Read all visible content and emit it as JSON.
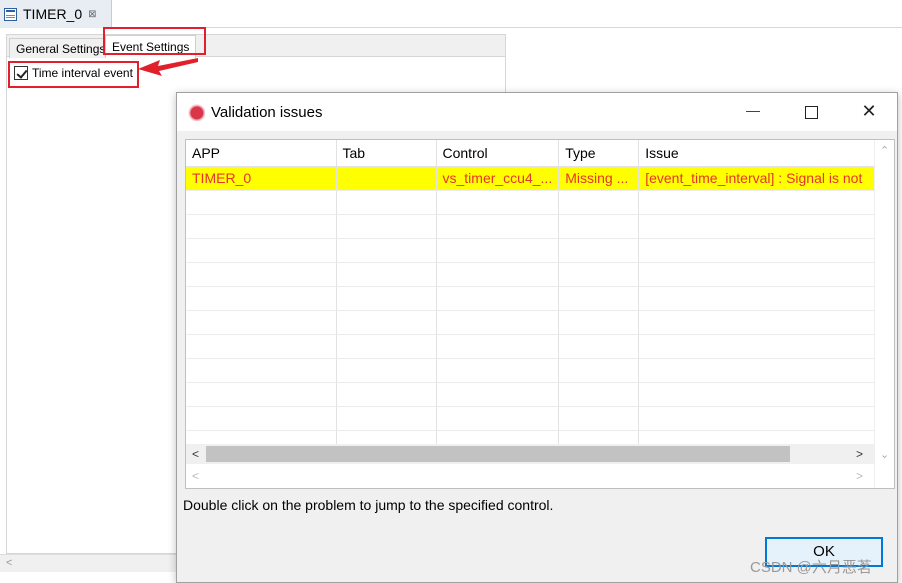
{
  "editor": {
    "tab_title": "TIMER_0",
    "close_glyph": "⊠",
    "settings_tabs": [
      "General Settings",
      "Event Settings"
    ],
    "checkbox_label": "Time interval event",
    "checkbox_checked": true
  },
  "dialog": {
    "title": "Validation issues",
    "columns": [
      "APP",
      "Tab",
      "Control",
      "Type",
      "Issue"
    ],
    "rows": [
      [
        "TIMER_0",
        "",
        "vs_timer_ccu4_...",
        "Missing ...",
        "[event_time_interval] : Signal is not"
      ]
    ],
    "empty_row_count": 11,
    "hint": "Double click on the problem to jump to the specified control.",
    "ok_label": "OK",
    "highlight_color": "#ffff00",
    "error_text_color": "#e6352b"
  },
  "annotation_color": "#e0202a",
  "watermark": "CSDN @六月恶茗"
}
